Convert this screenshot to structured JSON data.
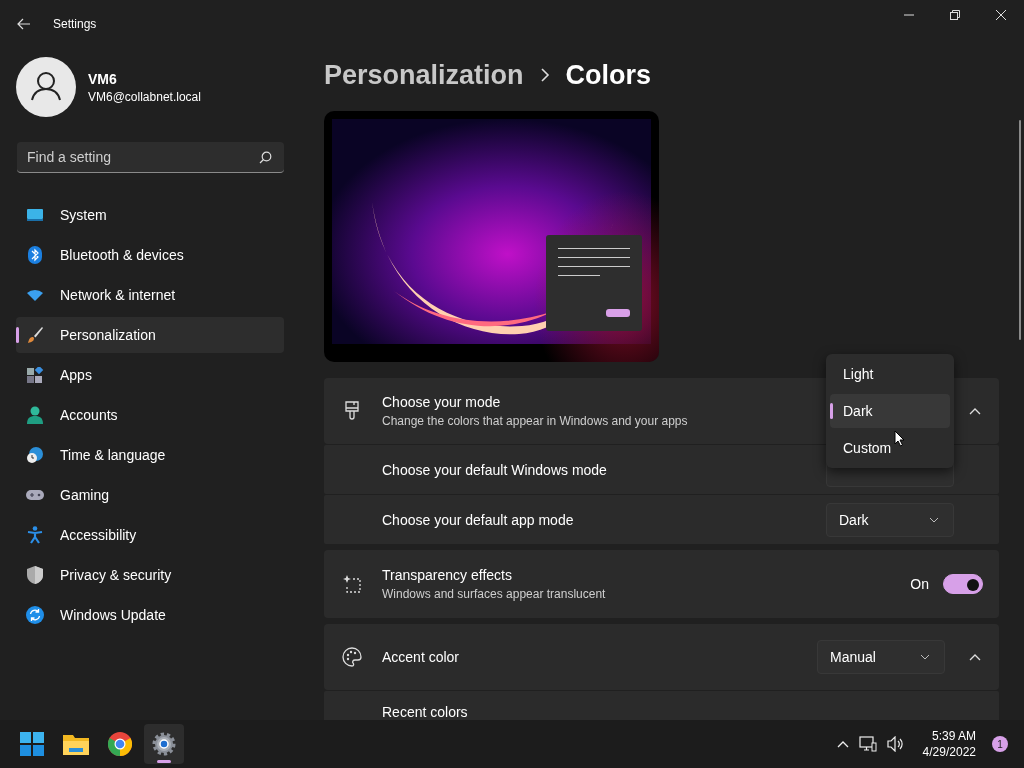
{
  "window": {
    "title": "Settings"
  },
  "user": {
    "name": "VM6",
    "email": "VM6@collabnet.local"
  },
  "search": {
    "placeholder": "Find a setting"
  },
  "nav": [
    {
      "label": "System",
      "selected": false
    },
    {
      "label": "Bluetooth & devices",
      "selected": false
    },
    {
      "label": "Network & internet",
      "selected": false
    },
    {
      "label": "Personalization",
      "selected": true
    },
    {
      "label": "Apps",
      "selected": false
    },
    {
      "label": "Accounts",
      "selected": false
    },
    {
      "label": "Time & language",
      "selected": false
    },
    {
      "label": "Gaming",
      "selected": false
    },
    {
      "label": "Accessibility",
      "selected": false
    },
    {
      "label": "Privacy & security",
      "selected": false
    },
    {
      "label": "Windows Update",
      "selected": false
    }
  ],
  "breadcrumb": {
    "parent": "Personalization",
    "current": "Colors"
  },
  "cards": [
    {
      "kind": "expander",
      "title": "Choose your mode",
      "description": "Change the colors that appear in Windows and your apps",
      "expanded": true,
      "rows": [
        {
          "title": "Choose your default Windows mode"
        },
        {
          "title": "Choose your default app mode",
          "value": "Dark"
        }
      ]
    },
    {
      "kind": "toggle",
      "title": "Transparency effects",
      "description": "Windows and surfaces appear translucent",
      "on": true,
      "state_label": "On"
    },
    {
      "kind": "expander",
      "title": "Accent color",
      "value": "Manual",
      "expanded": true,
      "rows": [
        {
          "title": "Recent colors"
        }
      ]
    }
  ],
  "mode_menu": {
    "options": [
      {
        "label": "Light",
        "selected": false
      },
      {
        "label": "Dark",
        "selected": true
      },
      {
        "label": "Custom",
        "selected": false
      }
    ]
  },
  "taskbar": {
    "apps": [
      {
        "active": false
      },
      {
        "active": false
      },
      {
        "active": false
      },
      {
        "active": true
      }
    ],
    "time": "5:39 AM",
    "date": "4/29/2022",
    "notification_count": "1"
  }
}
